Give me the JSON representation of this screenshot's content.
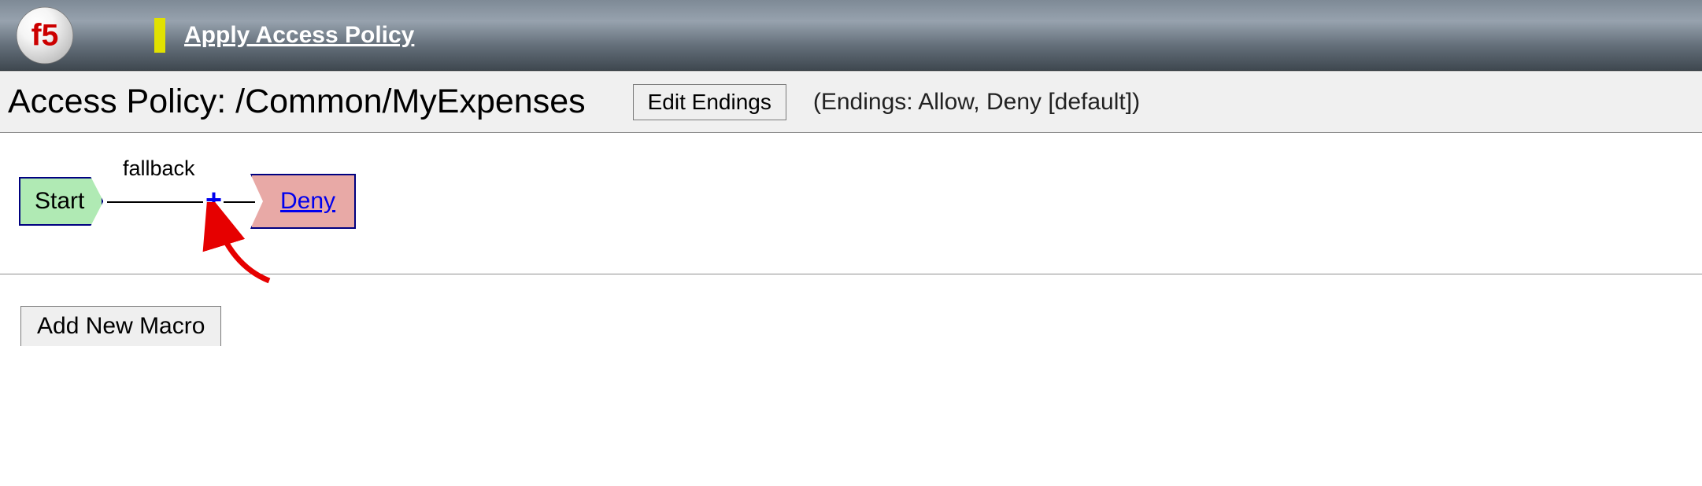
{
  "header": {
    "apply_access_policy_label": "Apply Access Policy"
  },
  "title_bar": {
    "policy_title": "Access Policy: /Common/MyExpenses",
    "edit_endings_label": "Edit Endings",
    "endings_info": "(Endings: Allow, Deny [default])"
  },
  "flow": {
    "start_label": "Start",
    "branch_label": "fallback",
    "plus_label": "+",
    "ending_label": "Deny"
  },
  "macro": {
    "add_new_macro_label": "Add New Macro"
  }
}
